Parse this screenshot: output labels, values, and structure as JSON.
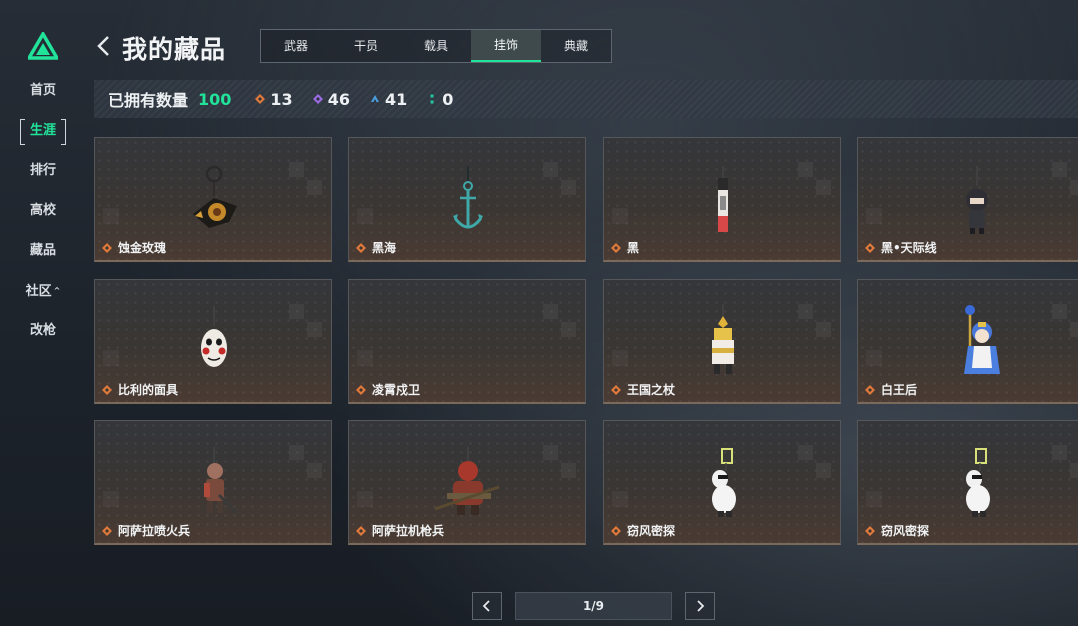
{
  "sidebar": {
    "items": [
      {
        "label": "首页",
        "active": false
      },
      {
        "label": "生涯",
        "active": true
      },
      {
        "label": "排行",
        "active": false
      },
      {
        "label": "高校",
        "active": false
      },
      {
        "label": "藏品",
        "active": false
      },
      {
        "label": "社区",
        "active": false,
        "expanded": true
      },
      {
        "label": "改枪",
        "active": false
      }
    ],
    "logo_icon": "triangle-logo-icon"
  },
  "header": {
    "title": "我的藏品",
    "back_icon": "chevron-left-icon",
    "tabs": [
      {
        "label": "武器",
        "active": false
      },
      {
        "label": "干员",
        "active": false
      },
      {
        "label": "载具",
        "active": false
      },
      {
        "label": "挂饰",
        "active": true
      },
      {
        "label": "典藏",
        "active": false
      }
    ]
  },
  "stats": {
    "label": "已拥有数量",
    "total": "100",
    "counts": [
      {
        "rarity": "orange",
        "value": "13",
        "color": "#e0793a"
      },
      {
        "rarity": "purple",
        "value": "46",
        "color": "#9b6be3"
      },
      {
        "rarity": "blue",
        "value": "41",
        "color": "#4a9ee0"
      },
      {
        "rarity": "green",
        "value": "0",
        "color": "#22c9a0"
      }
    ]
  },
  "items": [
    {
      "name": "蚀金玫瑰",
      "rarity": "orange",
      "art": "golden-rose-charm"
    },
    {
      "name": "黑海",
      "rarity": "orange",
      "art": "anchor-charm"
    },
    {
      "name": "黑",
      "rarity": "orange",
      "art": "tag-charm"
    },
    {
      "name": "黑•天际线",
      "rarity": "orange",
      "art": "figure-charm"
    },
    {
      "name": "比利的面具",
      "rarity": "orange",
      "art": "mask-charm"
    },
    {
      "name": "凌霄戍卫",
      "rarity": "orange",
      "art": "empty"
    },
    {
      "name": "王国之杖",
      "rarity": "orange",
      "art": "scepter-charm"
    },
    {
      "name": "白王后",
      "rarity": "orange",
      "art": "queen-charm"
    },
    {
      "name": "阿萨拉喷火兵",
      "rarity": "orange",
      "art": "flamethrower-charm"
    },
    {
      "name": "阿萨拉机枪兵",
      "rarity": "orange",
      "art": "gunner-charm"
    },
    {
      "name": "窃风密探",
      "rarity": "orange",
      "art": "rabbit-charm"
    },
    {
      "name": "窃风密探",
      "rarity": "orange",
      "art": "rabbit-charm"
    }
  ],
  "pagination": {
    "current": "1/9",
    "prev_icon": "chevron-left-icon",
    "next_icon": "chevron-right-icon"
  },
  "colors": {
    "accent": "#22e39a",
    "orange_gem": "#e0793a"
  }
}
